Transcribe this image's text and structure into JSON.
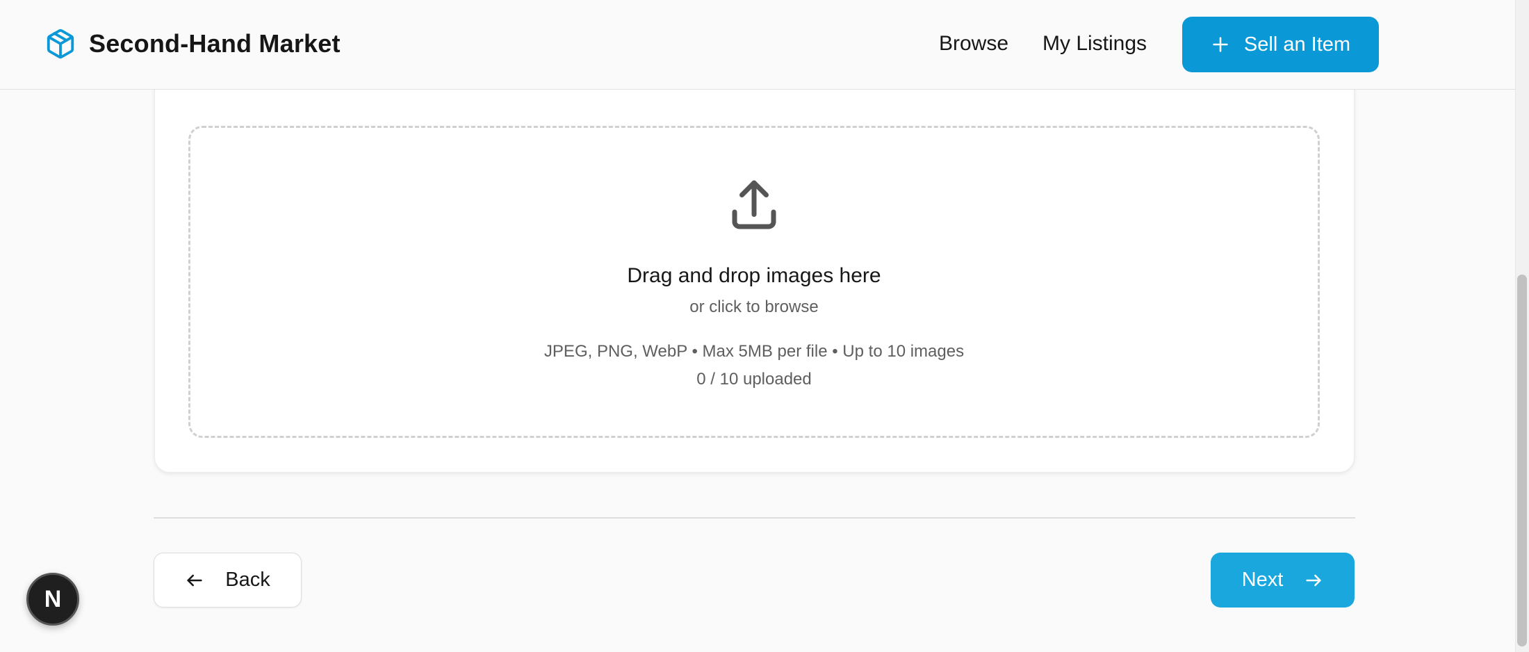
{
  "header": {
    "brand_name": "Second-Hand Market",
    "brand_icon": "package-box-icon",
    "nav": [
      {
        "label": "Browse"
      },
      {
        "label": "My Listings"
      }
    ],
    "sell_button_label": "Sell an Item"
  },
  "upload": {
    "icon": "upload-icon",
    "title": "Drag and drop images here",
    "subtitle": "or click to browse",
    "info": "JPEG, PNG, WebP • Max 5MB per file • Up to 10 images",
    "count_text": "0 / 10 uploaded"
  },
  "footer_nav": {
    "back_label": "Back",
    "next_label": "Next"
  },
  "dev_badge": {
    "letter": "N"
  },
  "colors": {
    "accent": "#0b98d6",
    "next_button": "#1aa7dd",
    "background": "#fafafa"
  }
}
